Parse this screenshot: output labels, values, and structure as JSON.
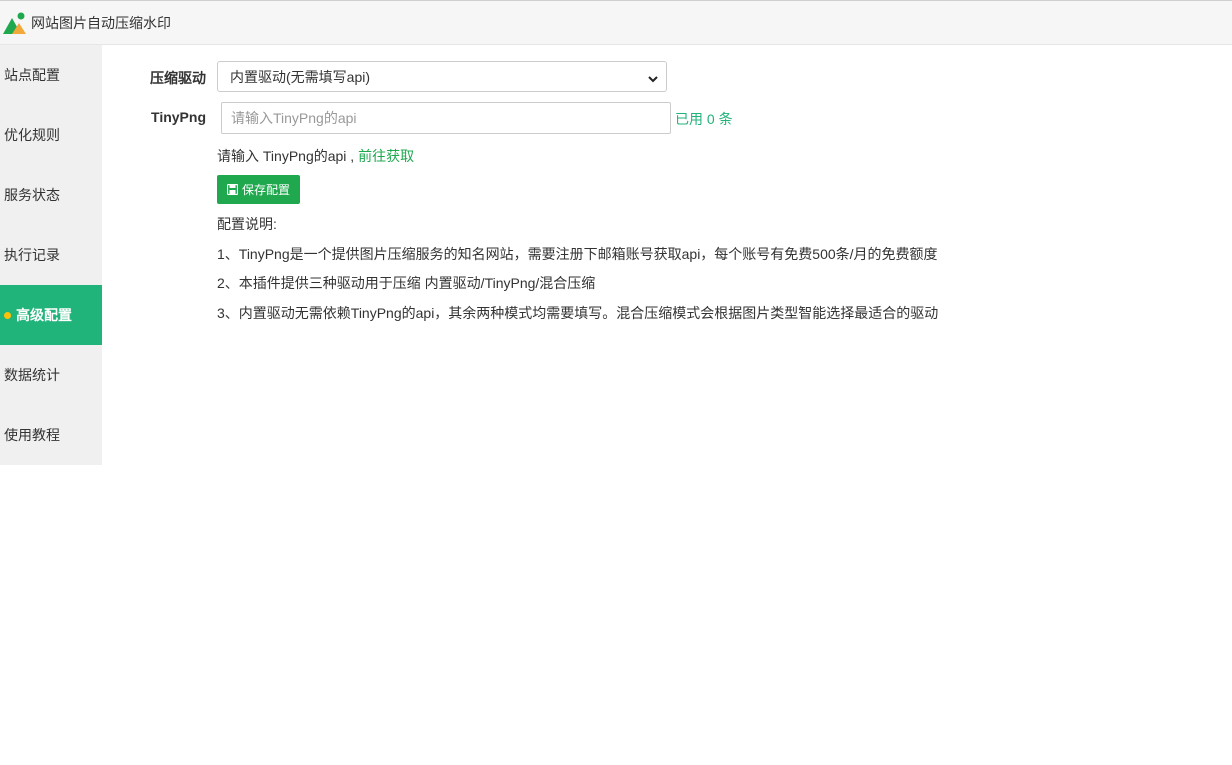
{
  "window": {
    "title": "网站图片自动压缩水印"
  },
  "colors": {
    "accent": "#20b37a",
    "button": "#20a84f",
    "dot": "#ffc107"
  },
  "sidebar": {
    "items": [
      {
        "label": "站点配置",
        "active": false
      },
      {
        "label": "优化规则",
        "active": false
      },
      {
        "label": "服务状态",
        "active": false
      },
      {
        "label": "执行记录",
        "active": false
      },
      {
        "label": "高级配置",
        "active": true
      },
      {
        "label": "数据统计",
        "active": false
      },
      {
        "label": "使用教程",
        "active": false
      }
    ]
  },
  "form": {
    "driver_label": "压缩驱动",
    "driver_value": "内置驱动(无需填写api)",
    "tinypng_label": "TinyPng",
    "tinypng_placeholder": "请输入TinyPng的api",
    "usage_text": "已用 0 条",
    "hint_text": "请输入 TinyPng的api ,",
    "hint_link": "前往获取",
    "save_label": "保存配置"
  },
  "notes": {
    "title": "配置说明:",
    "lines": [
      "1、TinyPng是一个提供图片压缩服务的知名网站，需要注册下邮箱账号获取api，每个账号有免费500条/月的免费额度",
      "2、本插件提供三种驱动用于压缩 内置驱动/TinyPng/混合压缩",
      "3、内置驱动无需依赖TinyPng的api，其余两种模式均需要填写。混合压缩模式会根据图片类型智能选择最适合的驱动"
    ]
  }
}
